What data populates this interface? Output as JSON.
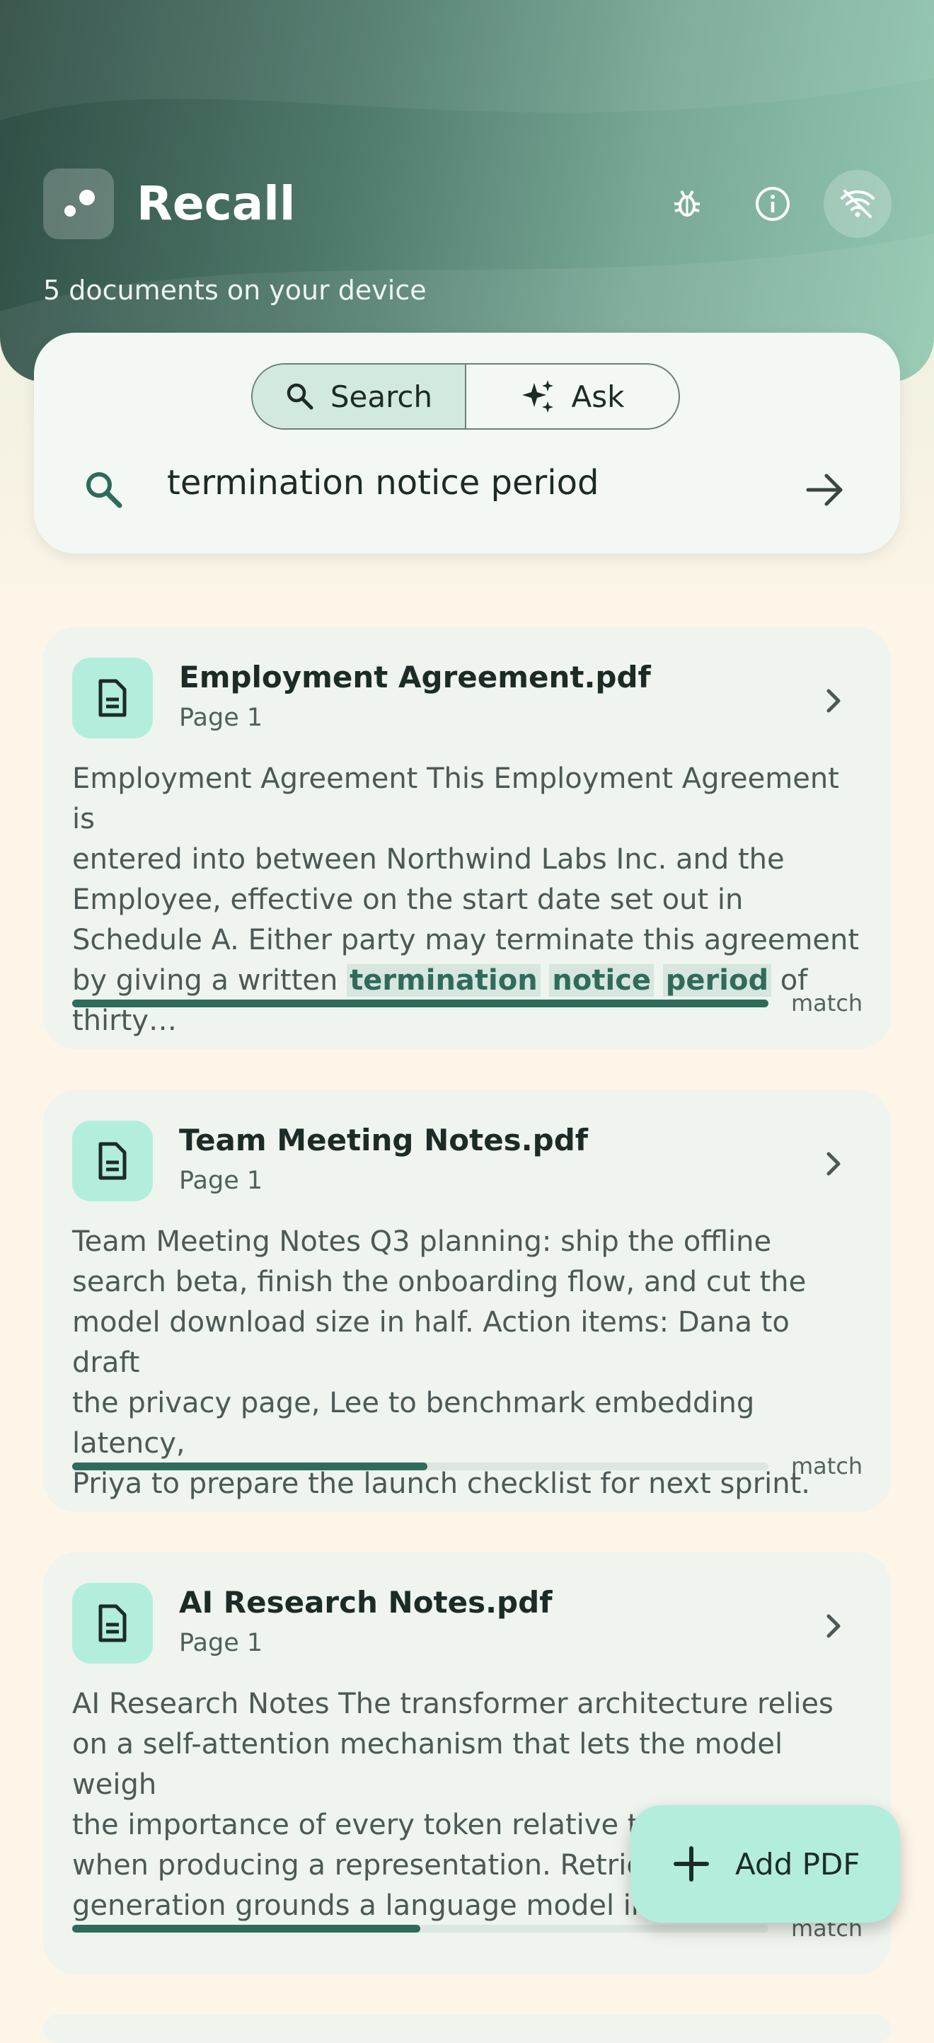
{
  "app": {
    "title": "Recall",
    "subtitle": "5 documents on your device"
  },
  "header_actions": [
    {
      "icon": "bug-icon"
    },
    {
      "icon": "info-icon"
    },
    {
      "icon": "wifi-off-icon"
    }
  ],
  "search": {
    "modes": [
      {
        "label": "Search",
        "icon": "search-icon",
        "active": true
      },
      {
        "label": "Ask",
        "icon": "sparkle-icon",
        "active": false
      }
    ],
    "query": "termination notice period"
  },
  "results": [
    {
      "title": "Employment Agreement.pdf",
      "page": "Page 1",
      "excerpt_before": "Employment Agreement This Employment Agreement is\nentered into between Northwind Labs Inc. and the\nEmployee, effective on the start date set out in\nSchedule A. Either party may terminate this agreement\nby giving a written ",
      "highlights": [
        "termination",
        "notice",
        "period"
      ],
      "excerpt_after": " of thirty…",
      "match_label": "match",
      "match_score": 1.0
    },
    {
      "title": "Team Meeting Notes.pdf",
      "page": "Page 1",
      "excerpt": "Team Meeting Notes Q3 planning: ship the offline\nsearch beta, finish the onboarding flow, and cut the\nmodel download size in half. Action items: Dana to draft\nthe privacy page, Lee to benchmark embedding latency,\nPriya to prepare the launch checklist for next sprint.",
      "match_label": "match",
      "match_score": 0.51
    },
    {
      "title": "AI Research Notes.pdf",
      "page": "Page 1",
      "excerpt": "AI Research Notes The transformer architecture relies\non a self-attention mechanism that lets the model weigh\nthe importance of every token relative to the others\nwhen producing a representation. Retrie\ngeneration grounds a language model in",
      "match_label": "match",
      "match_score": 0.5
    }
  ],
  "fab": {
    "label": "Add PDF",
    "icon": "plus-icon"
  },
  "colors": {
    "accent": "#2e6b5b",
    "accent_container": "#b2eedb",
    "background": "#fdf5e8",
    "card": "#eff4ef"
  }
}
